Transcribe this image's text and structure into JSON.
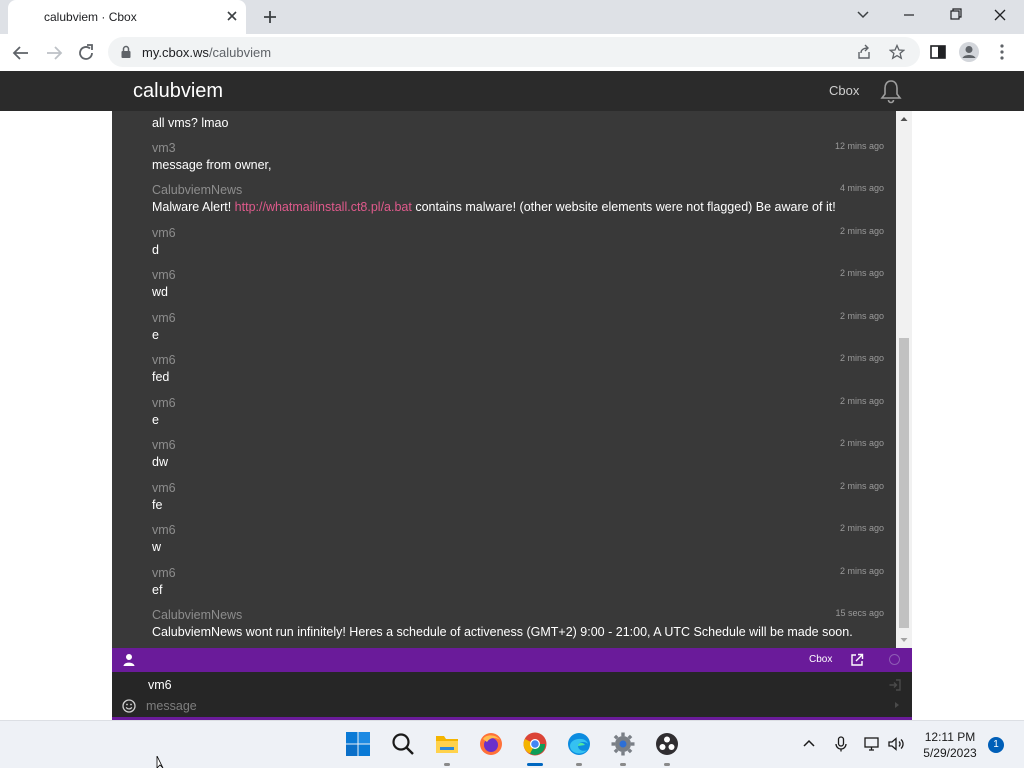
{
  "browser": {
    "tab_title": "calubviem · Cbox",
    "url_domain": "my.cbox.ws",
    "url_path": "/calubviem"
  },
  "site": {
    "title": "calubviem",
    "cbox_link": "Cbox",
    "accent_color": "#6a1b9a",
    "link_color": "#e05a8c"
  },
  "messages": [
    {
      "author": "",
      "time": "",
      "text": "all vms? lmao"
    },
    {
      "author": "vm3",
      "time": "12 mins ago",
      "text": "message from owner,"
    },
    {
      "author": "CalubviemNews",
      "time": "4 mins ago",
      "text_before": "Malware Alert! ",
      "link": "http://whatmailinstall.ct8.pl/a.bat",
      "text_after": " contains malware! (other website elements were not flagged) Be aware of it!"
    },
    {
      "author": "vm6",
      "time": "2 mins ago",
      "text": "d"
    },
    {
      "author": "vm6",
      "time": "2 mins ago",
      "text": "wd"
    },
    {
      "author": "vm6",
      "time": "2 mins ago",
      "text": "e"
    },
    {
      "author": "vm6",
      "time": "2 mins ago",
      "text": "fed"
    },
    {
      "author": "vm6",
      "time": "2 mins ago",
      "text": "e"
    },
    {
      "author": "vm6",
      "time": "2 mins ago",
      "text": "dw"
    },
    {
      "author": "vm6",
      "time": "2 mins ago",
      "text": "fe"
    },
    {
      "author": "vm6",
      "time": "2 mins ago",
      "text": "w"
    },
    {
      "author": "vm6",
      "time": "2 mins ago",
      "text": "ef"
    },
    {
      "author": "CalubviemNews",
      "time": "15 secs ago",
      "text": "CalubviemNews wont run infinitely! Heres a schedule of activeness (GMT+2) 9:00 - 21:00, A UTC Schedule will be made soon."
    }
  ],
  "chat_bar": {
    "cbox_label": "Cbox"
  },
  "composer": {
    "username": "vm6",
    "message_placeholder": "message"
  },
  "taskbar": {
    "time": "12:11 PM",
    "date": "5/29/2023",
    "notification_count": "1"
  }
}
